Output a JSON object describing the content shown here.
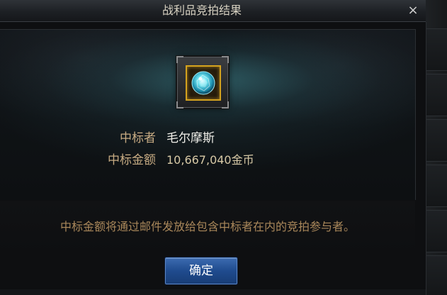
{
  "dialog": {
    "title": "战利品竞拍结果",
    "close_symbol": "×",
    "winner_label": "中标者",
    "winner_name": "毛尔摩斯",
    "amount_label": "中标金额",
    "amount_value": "10,667,040金币",
    "notice": "中标金额将通过邮件发放给包含中标者在内的竞拍参与者。",
    "confirm_label": "确定"
  },
  "icons": {
    "item": "blue-gem-in-gold-frame-icon",
    "close": "close-icon"
  },
  "colors": {
    "title_text": "#d8d2c2",
    "label_text": "#c7ab83",
    "winner_text": "#f0efe9",
    "notice_text": "#a9875a",
    "button_blue": "#1f4b8e",
    "item_border_gold": "#d4a21e",
    "gem_cyan": "#4fd7e6"
  }
}
